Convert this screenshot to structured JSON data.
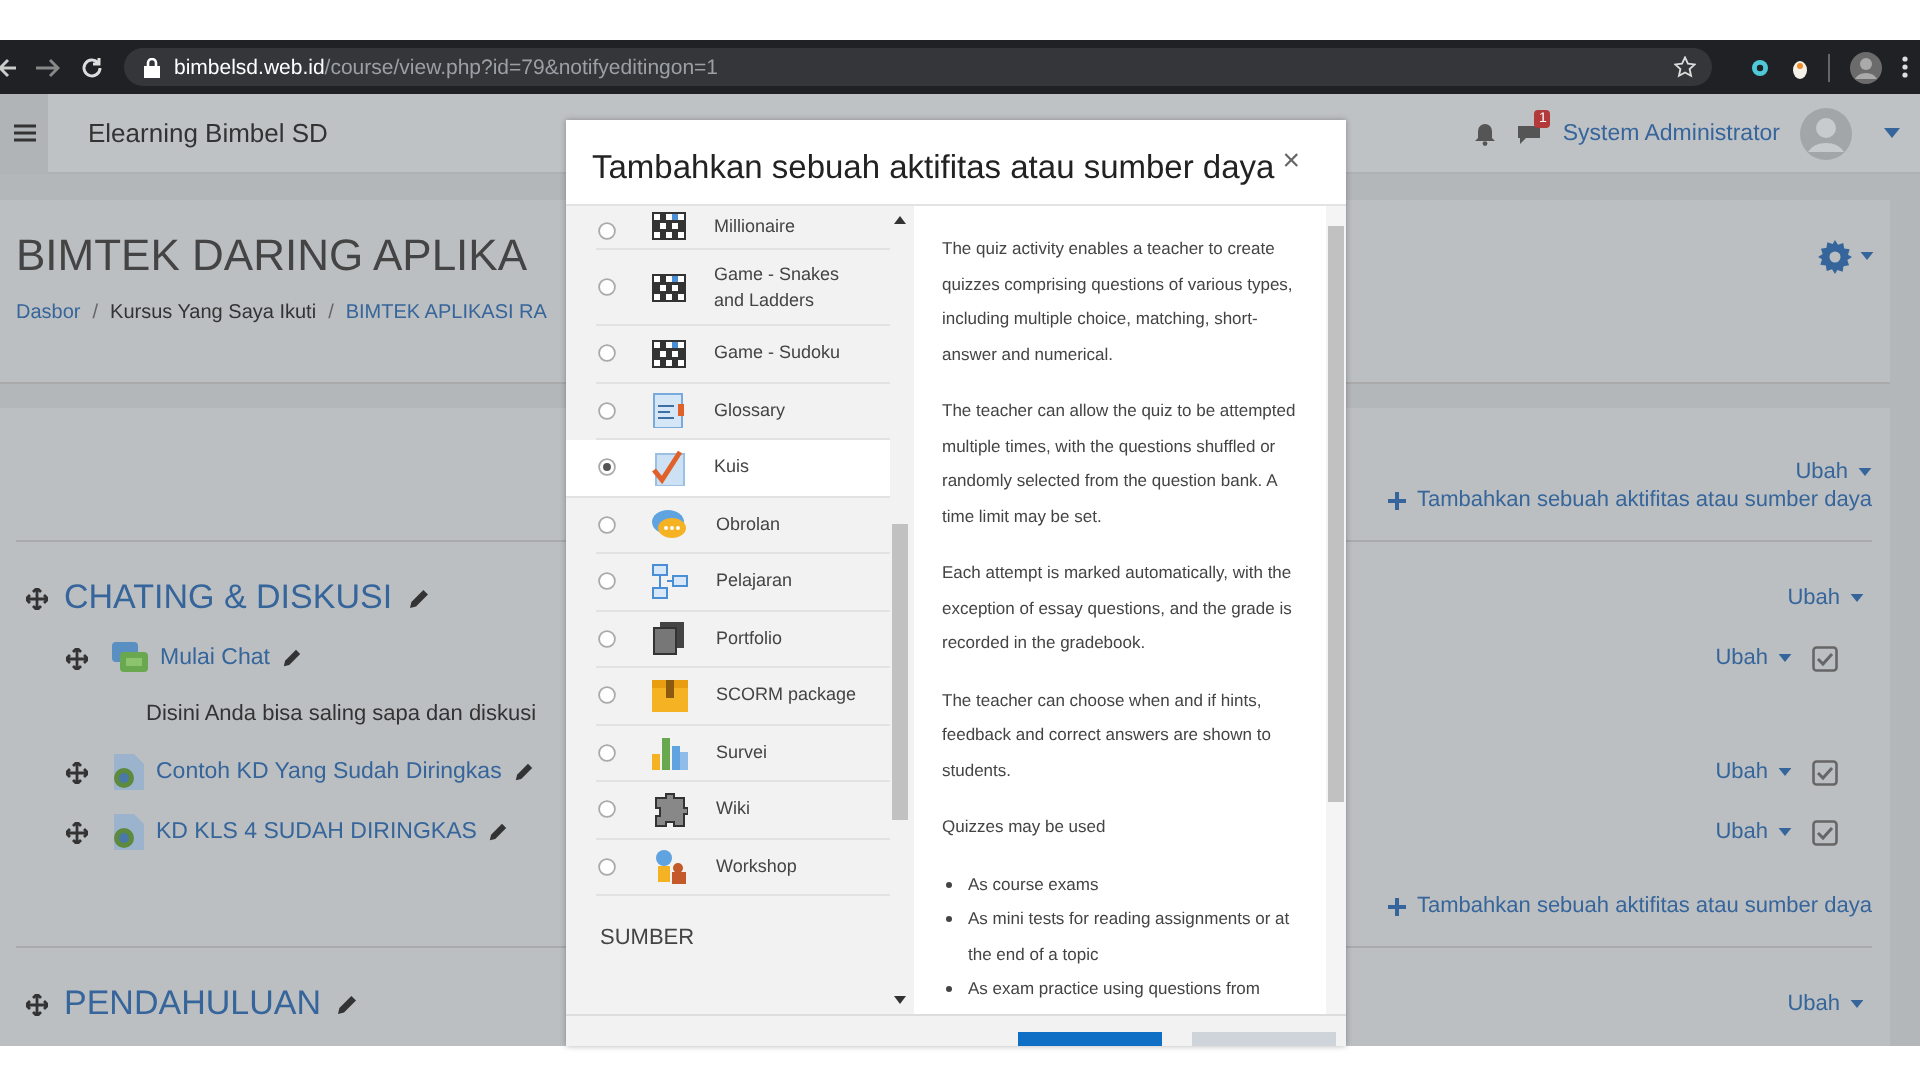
{
  "browser": {
    "url": "**bimbelsd.web.id**/course/view.php?id=79&notifyeditingon=1"
  },
  "navbar": {
    "site_name": "Elearning Bimbel SD",
    "notification_count": "1",
    "user_name": "System Administrator"
  },
  "header": {
    "course_title": "BIMTEK DARING APLIKA",
    "breadcrumbs": [
      {
        "label": "Dasbor",
        "link": true
      },
      {
        "label": "Kursus Yang Saya Ikuti",
        "link": false
      },
      {
        "label": "BIMTEK APLIKASI RA",
        "link": true
      }
    ],
    "breadcrumb_separators": [
      "/",
      "/"
    ]
  },
  "top_section": {
    "edit_label": "Ubah",
    "add_label": "Tambahkan sebuah aktifitas atau sumber daya"
  },
  "sections": [
    {
      "title": "CHATING & DISKUSI",
      "edit_label": "Ubah",
      "add_label": "Tambahkan sebuah aktifitas atau sumber daya",
      "activities": [
        {
          "kind": "chat",
          "name": "Mulai Chat",
          "description": "Disini Anda bisa saling sapa dan diskusi",
          "edit_label": "Ubah",
          "checked": true
        },
        {
          "kind": "url",
          "name": "Contoh KD Yang Sudah Diringkas",
          "edit_label": "Ubah",
          "checked": true
        },
        {
          "kind": "url",
          "name": "KD KLS 4 SUDAH DIRINGKAS",
          "edit_label": "Ubah",
          "checked": true
        }
      ]
    },
    {
      "title": "PENDAHULUAN",
      "edit_label": "Ubah"
    }
  ],
  "modal": {
    "title": "Tambahkan sebuah aktifitas atau sumber daya",
    "close": "×",
    "items": [
      {
        "label": "Millionaire",
        "selected": false
      },
      {
        "label": "Game - Snakes and Ladders",
        "selected": false
      },
      {
        "label": "Game - Sudoku",
        "selected": false
      },
      {
        "label": "Glossary",
        "selected": false
      },
      {
        "label": "Kuis",
        "selected": true
      },
      {
        "label": "Obrolan",
        "selected": false
      },
      {
        "label": "Pelajaran",
        "selected": false
      },
      {
        "label": "Portfolio",
        "selected": false
      },
      {
        "label": "SCORM package",
        "selected": false
      },
      {
        "label": "Survei",
        "selected": false
      },
      {
        "label": "Wiki",
        "selected": false
      },
      {
        "label": "Workshop",
        "selected": false
      }
    ],
    "group_heading": "SUMBER",
    "description": [
      {
        "kind": "paragraph",
        "text": "The quiz activity enables a teacher to create quizzes comprising questions of various types, including multiple choice, matching, short-answer and numerical."
      },
      {
        "kind": "paragraph",
        "text": "The teacher can allow the quiz to be attempted multiple times, with the questions shuffled or randomly selected from the question bank. A time limit may be set."
      },
      {
        "kind": "paragraph",
        "text": "Each attempt is marked automatically, with the exception of essay questions, and the grade is recorded in the gradebook."
      },
      {
        "kind": "paragraph",
        "text": "The teacher can choose when and if hints, feedback and correct answers are shown to students."
      },
      {
        "kind": "paragraph",
        "text": "Quizzes may be used"
      },
      {
        "kind": "bullet",
        "text": "As course exams"
      },
      {
        "kind": "bullet",
        "text": "As mini tests for reading assignments or at the end of a topic"
      },
      {
        "kind": "bullet",
        "text": "As exam practice using questions from"
      }
    ]
  }
}
